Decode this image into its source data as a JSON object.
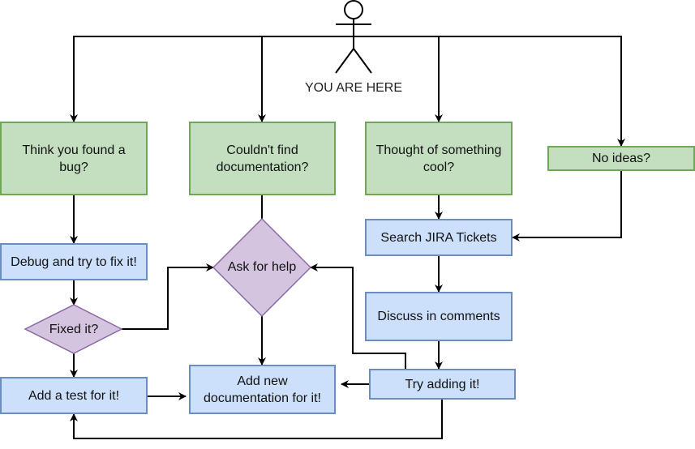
{
  "diagram": {
    "actor": {
      "label": "YOU ARE HERE"
    },
    "nodes": {
      "bug": "Think you found a bug?",
      "nodoc": "Couldn't find documentation?",
      "cool": "Thought of something cool?",
      "noideas": "No ideas?",
      "debug": "Debug and try to fix it!",
      "fixed": "Fixed it?",
      "help": "Ask for help",
      "jira": "Search JIRA Tickets",
      "discuss": "Discuss in comments",
      "test": "Add a test for it!",
      "doc": "Add new documentation for it!",
      "try": "Try adding it!"
    },
    "colors": {
      "start_fill": "#c3dfc0",
      "start_stroke": "#6ea755",
      "process_fill": "#cce0fb",
      "process_stroke": "#6c8ebf",
      "decision_fill": "#d5c4e0",
      "decision_stroke": "#8b68a6",
      "edge": "#000000"
    },
    "edges": [
      {
        "from": "actor",
        "to": "bug"
      },
      {
        "from": "actor",
        "to": "nodoc"
      },
      {
        "from": "actor",
        "to": "cool"
      },
      {
        "from": "actor",
        "to": "noideas"
      },
      {
        "from": "bug",
        "to": "debug"
      },
      {
        "from": "debug",
        "to": "fixed"
      },
      {
        "from": "fixed",
        "to": "help"
      },
      {
        "from": "fixed",
        "to": "test"
      },
      {
        "from": "nodoc",
        "to": "help"
      },
      {
        "from": "help",
        "to": "doc"
      },
      {
        "from": "cool",
        "to": "jira"
      },
      {
        "from": "noideas",
        "to": "jira"
      },
      {
        "from": "jira",
        "to": "discuss"
      },
      {
        "from": "discuss",
        "to": "try"
      },
      {
        "from": "try",
        "to": "help"
      },
      {
        "from": "try",
        "to": "doc"
      },
      {
        "from": "try",
        "to": "test"
      },
      {
        "from": "test",
        "to": "doc"
      }
    ]
  }
}
